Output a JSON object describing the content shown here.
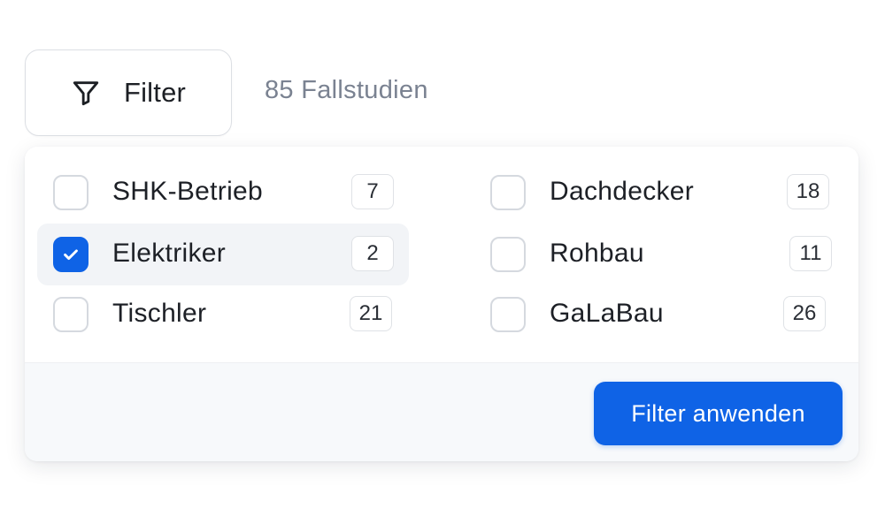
{
  "toolbar": {
    "filter_label": "Filter",
    "result_count": "85 Fallstudien"
  },
  "filter_options": [
    {
      "label": "SHK-Betrieb",
      "count": "7",
      "checked": false
    },
    {
      "label": "Dachdecker",
      "count": "18",
      "checked": false
    },
    {
      "label": "Elektriker",
      "count": "2",
      "checked": true
    },
    {
      "label": "Rohbau",
      "count": "11",
      "checked": false
    },
    {
      "label": "Tischler",
      "count": "21",
      "checked": false
    },
    {
      "label": "GaLaBau",
      "count": "26",
      "checked": false
    }
  ],
  "footer": {
    "apply_label": "Filter anwenden"
  },
  "icons": {
    "filter": "funnel-icon",
    "check": "checkmark-icon"
  },
  "colors": {
    "accent": "#0f63e6",
    "muted_text": "#7a8291",
    "checked_row_bg": "#f2f4f7",
    "footer_bg": "#f7f9fb"
  }
}
